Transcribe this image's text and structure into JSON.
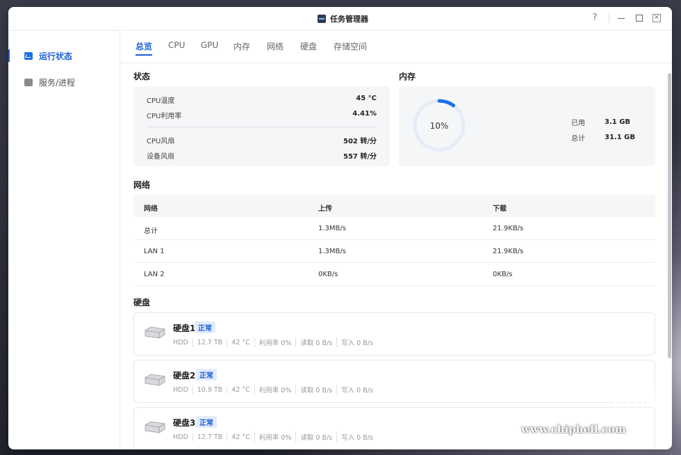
{
  "window": {
    "title": "任务管理器"
  },
  "controls": {
    "help": "?"
  },
  "sidebar": {
    "items": [
      {
        "label": "运行状态",
        "icon": "chart-icon",
        "active": true
      },
      {
        "label": "服务/进程",
        "icon": "services-icon",
        "active": false
      }
    ]
  },
  "tabs": [
    "总览",
    "CPU",
    "GPU",
    "内存",
    "网络",
    "硬盘",
    "存储空间"
  ],
  "status": {
    "title": "状态",
    "cpu_temp_label": "CPU温度",
    "cpu_temp": "45 °C",
    "cpu_usage_label": "CPU利用率",
    "cpu_usage": "4.41%",
    "cpu_fan_label": "CPU风扇",
    "cpu_fan": "502 转/分",
    "dev_fan_label": "设备风扇",
    "dev_fan": "557 转/分"
  },
  "memory": {
    "title": "内存",
    "percent_label": "10%",
    "percent": 0.1,
    "used_label": "已用",
    "used": "3.1 GB",
    "total_label": "总计",
    "total": "31.1 GB",
    "accent": "#1d6fe6"
  },
  "network": {
    "title": "网络",
    "headers": [
      "网络",
      "上传",
      "下载"
    ],
    "rows": [
      [
        "总计",
        "1.3MB/s",
        "21.9KB/s"
      ],
      [
        "LAN 1",
        "1.3MB/s",
        "21.9KB/s"
      ],
      [
        "LAN 2",
        "0KB/s",
        "0KB/s"
      ]
    ]
  },
  "disks": {
    "title": "硬盘",
    "items": [
      {
        "name": "硬盘1",
        "status": "正常",
        "type": "HDD",
        "size": "12.7 TB",
        "temp": "42 °C",
        "usage": "利用率 0%",
        "read": "读取 0 B/s",
        "write": "写入 0 B/s"
      },
      {
        "name": "硬盘2",
        "status": "正常",
        "type": "HDD",
        "size": "10.9 TB",
        "temp": "42 °C",
        "usage": "利用率 0%",
        "read": "读取 0 B/s",
        "write": "写入 0 B/s"
      },
      {
        "name": "硬盘3",
        "status": "正常",
        "type": "HDD",
        "size": "12.7 TB",
        "temp": "42 °C",
        "usage": "利用率 0%",
        "read": "读取 0 B/s",
        "write": "写入 0 B/s"
      }
    ]
  },
  "watermark": {
    "text": "www.chiphell.com"
  }
}
